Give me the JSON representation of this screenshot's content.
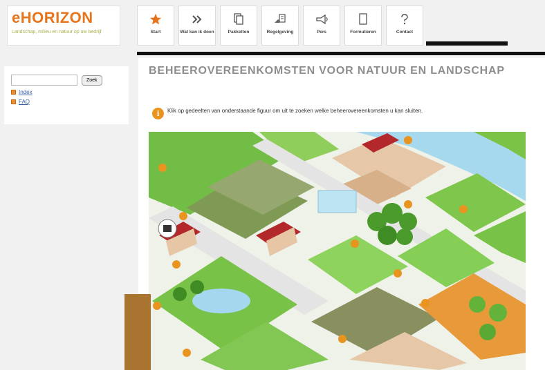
{
  "logo": {
    "title": "eHORIZON",
    "subtitle": "Landschap, milieu en natuur op uw bedrijf"
  },
  "nav": [
    {
      "label": "Start",
      "icon": "star-icon"
    },
    {
      "label": "Wat kan ik doen",
      "icon": "double-chevron-icon"
    },
    {
      "label": "Pakketten",
      "icon": "pages-icon"
    },
    {
      "label": "Regelgeving",
      "icon": "hand-document-icon"
    },
    {
      "label": "Pers",
      "icon": "megaphone-icon"
    },
    {
      "label": "Formulieren",
      "icon": "form-icon"
    },
    {
      "label": "Contact",
      "icon": "question-icon"
    }
  ],
  "sidebar": {
    "search_button": "Zoek",
    "search_value": "",
    "links": [
      "Index",
      "FAQ"
    ]
  },
  "main": {
    "title": "BEHEEROVEREENKOMSTEN VOOR NATUUR EN LANDSCHAP",
    "intro": "Klik op gedeelten van onderstaande figuur om uit te zoeken welke beheerovereenkomsten u kan sluiten."
  },
  "colors": {
    "brand_orange": "#e8741b",
    "grass": "#79c548",
    "water": "#a9dcef",
    "field_tan": "#e7c8a9",
    "barn_red": "#b3282b"
  }
}
